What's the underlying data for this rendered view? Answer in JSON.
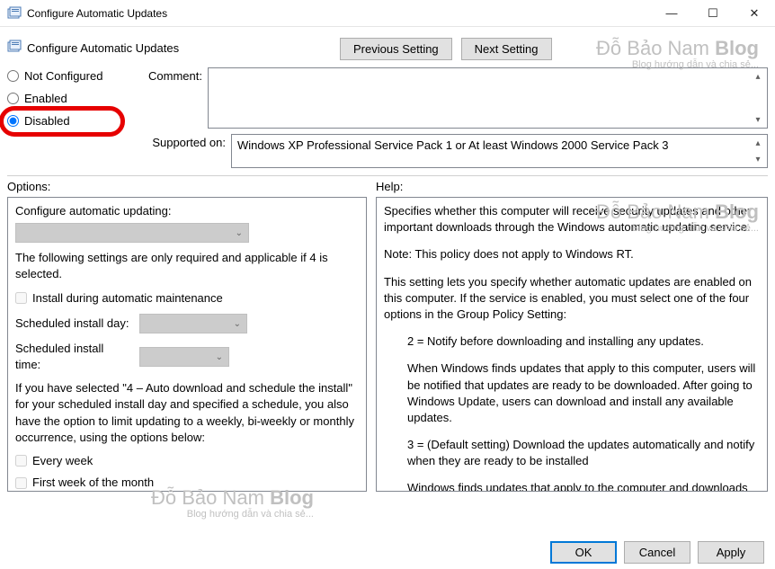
{
  "window": {
    "title": "Configure Automatic Updates",
    "min": "—",
    "max": "☐",
    "close": "✕"
  },
  "header": {
    "title": "Configure Automatic Updates",
    "prev": "Previous Setting",
    "next": "Next Setting"
  },
  "policy": {
    "not_configured": "Not Configured",
    "enabled": "Enabled",
    "disabled": "Disabled",
    "selected": "disabled"
  },
  "comment": {
    "label": "Comment:",
    "value": ""
  },
  "supported": {
    "label": "Supported on:",
    "value": "Windows XP Professional Service Pack 1 or At least Windows 2000 Service Pack 3"
  },
  "panels": {
    "options": "Options:",
    "help": "Help:"
  },
  "options": {
    "section_label": "Configure automatic updating:",
    "required_text": "The following settings are only required and applicable if 4 is selected.",
    "install_maintenance": "Install during automatic maintenance",
    "day_label": "Scheduled install day:",
    "time_label": "Scheduled install time:",
    "schedule_text": "If you have selected \"4 – Auto download and schedule the install\" for your scheduled install day and specified a schedule, you also have the option to limit updating to a weekly, bi-weekly or monthly occurrence, using the options below:",
    "every_week": "Every week",
    "first_week": "First week of the month"
  },
  "help": {
    "p1": "Specifies whether this computer will receive security updates and other important downloads through the Windows automatic updating service.",
    "p2": "Note: This policy does not apply to Windows RT.",
    "p3": "This setting lets you specify whether automatic updates are enabled on this computer. If the service is enabled, you must select one of the four options in the Group Policy Setting:",
    "p4": "2 = Notify before downloading and installing any updates.",
    "p5": "When Windows finds updates that apply to this computer, users will be notified that updates are ready to be downloaded. After going to Windows Update, users can download and install any available updates.",
    "p6": "3 = (Default setting) Download the updates automatically and notify when they are ready to be installed",
    "p7": "Windows finds updates that apply to the computer and downloads them in the background (the user is not notified or interrupted during this process). When the downloads are complete, users will be notified that they are ready to install. After"
  },
  "footer": {
    "ok": "OK",
    "cancel": "Cancel",
    "apply": "Apply"
  },
  "watermark": {
    "big_a": "Đỗ Bảo Nam ",
    "big_b": "Blog",
    "small": "Blog hướng dẫn và chia sẻ..."
  }
}
